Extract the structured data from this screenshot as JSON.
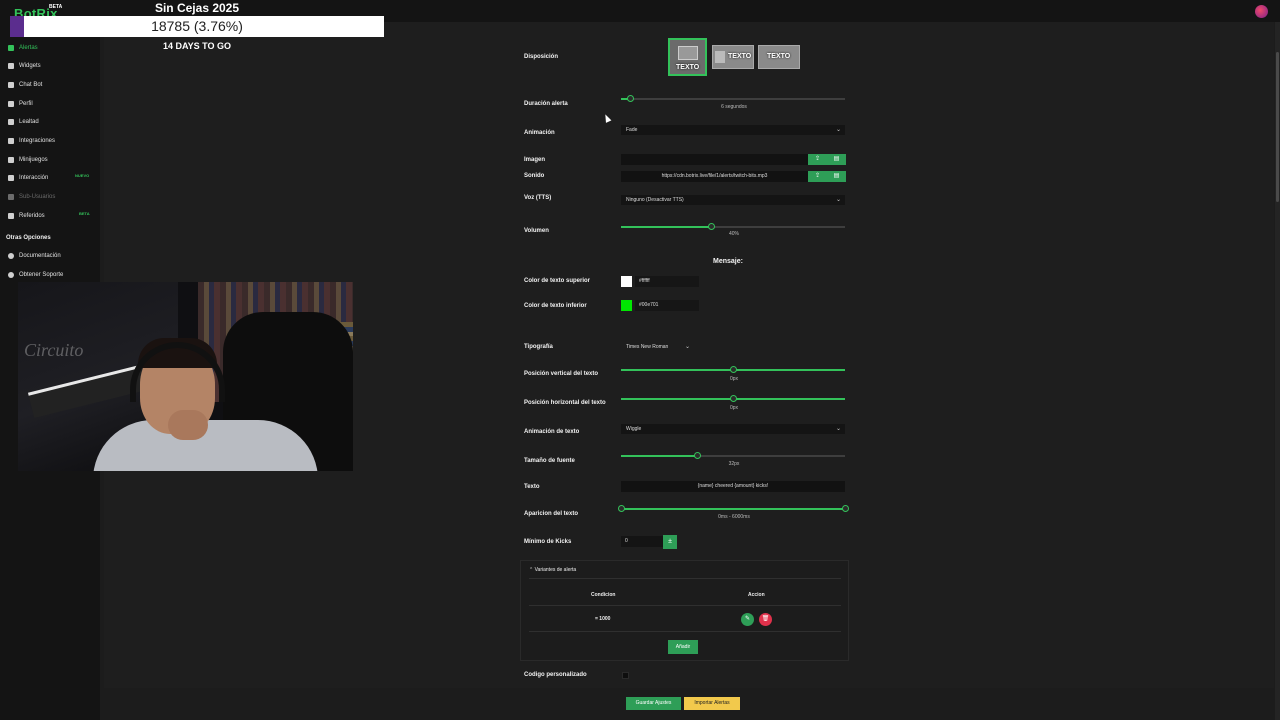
{
  "brand": {
    "name": "BotRix",
    "tag": "BETA"
  },
  "goal": {
    "title": "Sin Cejas 2025",
    "progress_text": "18785 (3.76%)",
    "progress_fraction": 0.0376,
    "days_text": "14 DAYS TO GO"
  },
  "sidebar": {
    "items": [
      {
        "label": "Alertas",
        "icon": "bell-icon",
        "active": true
      },
      {
        "label": "Widgets",
        "icon": "grid-icon"
      },
      {
        "label": "Chat Bot",
        "icon": "cloud-icon"
      },
      {
        "label": "Perfil",
        "icon": "id-card-icon"
      },
      {
        "label": "Lealtad",
        "icon": "trophy-icon"
      },
      {
        "label": "Integraciones",
        "icon": "plug-icon"
      },
      {
        "label": "Minijuegos",
        "icon": "gamepad-icon"
      },
      {
        "label": "Interacción",
        "icon": "bolt-icon",
        "badge": "NUEVO"
      },
      {
        "label": "Sub-Usuarios",
        "icon": "users-icon",
        "muted": true
      },
      {
        "label": "Referidos",
        "icon": "people-icon",
        "badge": "BETA"
      }
    ],
    "other_title": "Otras Opciones",
    "other_items": [
      {
        "label": "Documentación",
        "icon": "doc-icon"
      },
      {
        "label": "Obtener Soporte",
        "icon": "support-icon"
      }
    ]
  },
  "form": {
    "layout_label": "Disposición",
    "layout_options": [
      "TEXTO",
      "TEXTO",
      "TEXTO"
    ],
    "duration_label": "Duración alerta",
    "duration_value": "6 segundos",
    "duration_fraction": 0.04,
    "animation_label": "Animación",
    "animation_value": "Fade",
    "image_label": "Imagen",
    "image_value": "",
    "sound_label": "Sonido",
    "sound_value": "https://cdn.botrix.live/file/1/alerts/twitch-bits.mp3",
    "tts_label": "Voz (TTS)",
    "tts_value": "Ninguno (Desactivar TTS)",
    "volume_label": "Volumen",
    "volume_value": "40%",
    "volume_fraction": 0.4,
    "message_heading": "Mensaje:",
    "top_color_label": "Color de texto superior",
    "top_color_value": "#ffffff",
    "top_color": "#ffffff",
    "bottom_color_label": "Color de texto inferior",
    "bottom_color_value": "#00e701",
    "bottom_color": "#00e701",
    "font_label": "Tipografía",
    "font_value": "Times New Roman",
    "vpos_label": "Posición vertical del texto",
    "vpos_value": "0px",
    "vpos_fraction": 0.5,
    "hpos_label": "Posición horizontal del texto",
    "hpos_value": "0px",
    "hpos_fraction": 0.5,
    "text_anim_label": "Animación de texto",
    "text_anim_value": "Wiggle",
    "font_size_label": "Tamaño de fuente",
    "font_size_value": "32px",
    "font_size_fraction": 0.34,
    "text_label": "Texto",
    "text_value": "{name} cheered {amount} kicks!",
    "appear_label": "Aparicion del texto",
    "appear_value": "0ms - 6000ms",
    "min_label": "Mínimo de Kicks",
    "min_value": "0",
    "variants_title": "Variantes de alerta",
    "variants_col_condition": "Condicion",
    "variants_col_action": "Accion",
    "variants_row_condition": "= 1000",
    "variants_add": "Añadir",
    "custom_code_label": "Codigo personalizado",
    "save_label": "Guardar Ajustes",
    "import_label": "Importar Alertas"
  },
  "colors": {
    "accent": "#33c25a",
    "danger": "#e0314b",
    "warning": "#f2c94c"
  }
}
